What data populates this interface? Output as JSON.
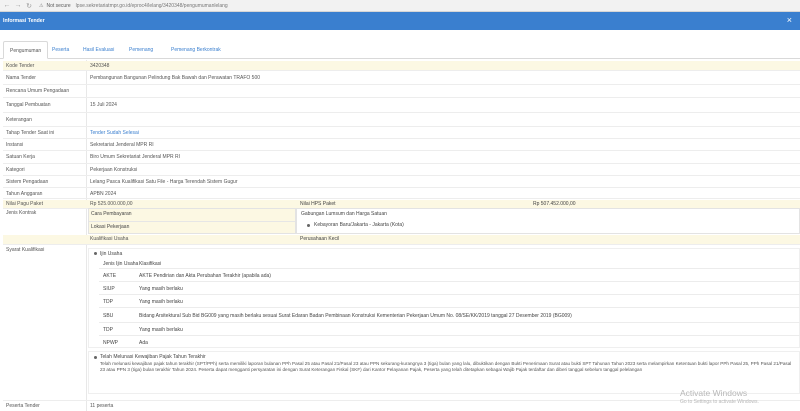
{
  "browser": {
    "not_secure": "Not secure",
    "url": "lpse.sekretariatmpr.go.id/eproc4/lelang/3420348/pengumumanlelang"
  },
  "modal": {
    "title": "Informasi Tender",
    "close": "×"
  },
  "tabs": [
    "Pengumuman",
    "Peserta",
    "Hasil Evaluasi",
    "Pemenang",
    "Pemenang Berkontrak"
  ],
  "rows": [
    {
      "label": "Kode Tender",
      "value": "3420348"
    },
    {
      "label": "Nama Tender",
      "value": "Pembangunan Bangunan Pelindung Bak Bawah dan Perawatan TRAFO 500"
    },
    {
      "label": "Rencana Umum Pengadaan",
      "value": ""
    },
    {
      "label": "Tanggal Pembuatan",
      "value": "15 Juli 2024"
    },
    {
      "label": "Keterangan",
      "value": ""
    },
    {
      "label": "Tahap Tender Saat ini",
      "value": "Tender Sudah Selesai"
    },
    {
      "label": "Instansi",
      "value": "Sekretariat Jenderal MPR RI"
    },
    {
      "label": "Satuan Kerja",
      "value": "Biro Umum Sekretariat Jenderal MPR RI"
    },
    {
      "label": "Kategori",
      "value": "Pekerjaan Konstruksi"
    },
    {
      "label": "Sistem Pengadaan",
      "value": "Lelang Pasca Kualifikasi Satu File - Harga Terendah Sistem Gugur"
    },
    {
      "label": "Tahun Anggaran",
      "value": "APBN 2024"
    }
  ],
  "pagu": {
    "label": "Nilai Pagu Paket",
    "value": "Rp 525.000.000,00",
    "hps_label": "Nilai HPS Paket",
    "hps_value": "Rp 507.452.000,00"
  },
  "kontrak": {
    "label": "Jenis Kontrak",
    "cara_label": "Cara Pembayaran",
    "cara_value": "Gabungan Lumsum dan Harga Satuan",
    "lokasi_label": "Lokasi Pekerjaan",
    "lokasi_value": "Kebayoran Baru/Jakarta - Jakarta (Kota)"
  },
  "kualifikasi": {
    "label": "Kualifikasi Usaha",
    "value": "Perusahaan Kecil"
  },
  "syarat": {
    "label": "Syarat Kualifikasi",
    "ijin_header": "Ijin Usaha",
    "table_header": {
      "jenis": "Jenis Ijin Usaha",
      "klasifikasi": "Klasifikasi"
    },
    "items": [
      {
        "jenis": "AKTE",
        "ket": "AKTE Pendirian dan Akta Perubahan Terakhir (apabila ada)"
      },
      {
        "jenis": "SIUP",
        "ket": "Yang masih berlaku"
      },
      {
        "jenis": "TDP",
        "ket": "Yang masih berlaku"
      },
      {
        "jenis": "SBU",
        "ket": "Bidang Arsitektural Sub Bid BG009 yang masih berlaku sesuai Surat Edaran Badan Pembinaan Konstruksi Kementerian Pekerjaan Umum No. 08/SE/KK/2019 tanggal 27 Desember 2019 (BG009)"
      },
      {
        "jenis": "TDP",
        "ket": "Yang masih berlaku"
      },
      {
        "jenis": "NPWP",
        "ket": "Ada"
      }
    ],
    "pajak_title": "Telah Melunasi Kewajiban Pajak Tahun Terakhir",
    "pajak_text": "Telah melunasi kewajiban pajak tahun terakhir (SPT/PPh) serta memiliki laporan bulanan PPh Pasal 25 atau Pasal 21/Pasal 23 atau PPN sekurang-kurangnya 3 (tiga) bulan yang lalu, dibuktikan dengan Bukti Penerimaan Surat atau bukti SPT Tahunan Tahun 2023 serta melampirkan Ketentuan bukti lapor PPh Pasal 25, PPh Pasal 21/Pasal 23 atau PPN 3 (tiga) bulan terakhir Tahun 2024. Peserta dapat mengganti persyaratan ini dengan Surat Keterangan Fiskal (SKF) dari Kantor Pelayanan Pajak, Peserta yang telah ditetapkan sebagai Wajib Pajak terdaftar dan diberi tanggal sebelum tanggal pelelangan"
  },
  "peserta": {
    "label": "Peserta Tender",
    "value": "11 peserta"
  },
  "watermark": {
    "title": "Activate Windows",
    "subtitle": "Go to Settings to activate Windows."
  }
}
